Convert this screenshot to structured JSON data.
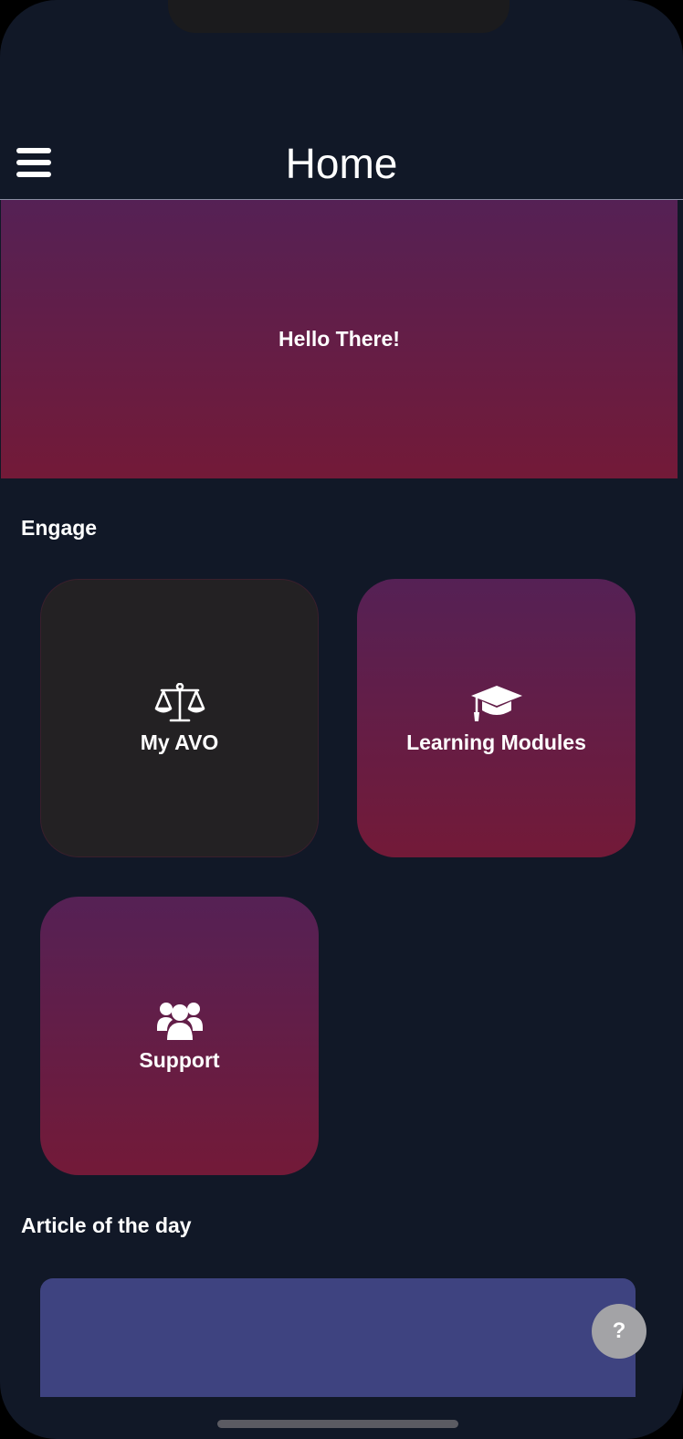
{
  "header": {
    "title": "Home",
    "menu_icon": "hamburger-menu-icon"
  },
  "hero": {
    "greeting": "Hello There!",
    "gradient": [
      "#552155",
      "#731a38"
    ]
  },
  "engage": {
    "title": "Engage",
    "cards": [
      {
        "label": "My AVO",
        "icon": "scale-icon",
        "style": "dark"
      },
      {
        "label": "Learning Modules",
        "icon": "graduation-cap-icon",
        "style": "gradient"
      },
      {
        "label": "Support",
        "icon": "users-group-icon",
        "style": "gradient"
      }
    ]
  },
  "article": {
    "title": "Article of the day"
  },
  "help": {
    "label": "?"
  },
  "colors": {
    "background": "#111827",
    "card_dark": "#232123",
    "article_card": "#3e4380",
    "help_button": "#a3a3a6"
  }
}
